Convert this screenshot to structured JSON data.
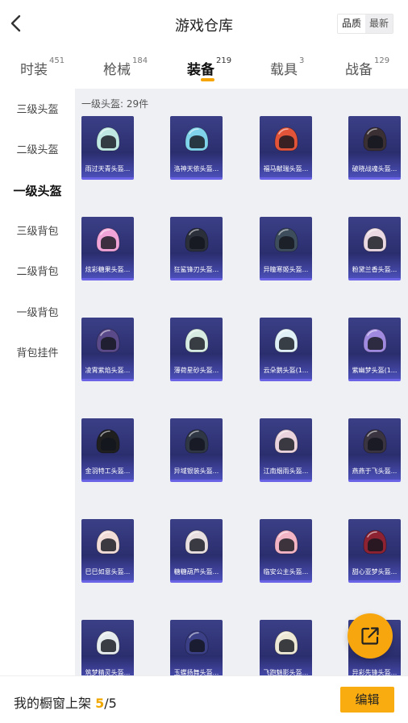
{
  "header": {
    "title": "游戏仓库",
    "sort_options": [
      "品质",
      "最新"
    ],
    "active_sort": "最新"
  },
  "tabs": [
    {
      "label": "时装",
      "count": "451"
    },
    {
      "label": "枪械",
      "count": "184"
    },
    {
      "label": "装备",
      "count": "219"
    },
    {
      "label": "载具",
      "count": "3"
    },
    {
      "label": "战备",
      "count": "129"
    }
  ],
  "active_tab": "装备",
  "sidebar": {
    "items": [
      "三级头盔",
      "二级头盔",
      "一级头盔",
      "三级背包",
      "二级背包",
      "一级背包",
      "背包挂件"
    ],
    "active": "一级头盔"
  },
  "section": {
    "label": "一级头盔: 29件"
  },
  "items": [
    {
      "name": "雨过天青头盔...",
      "color": "#bfe8e2"
    },
    {
      "name": "洛神天依头盔...",
      "color": "#7fd3ea"
    },
    {
      "name": "福马献瑞头盔...",
      "color": "#e2543a"
    },
    {
      "name": "破晓战魂头盔...",
      "color": "#3a2f33"
    },
    {
      "name": "炫彩糖果头盔...",
      "color": "#f0a4d8"
    },
    {
      "name": "狂鲨锋刃头盔...",
      "color": "#2b2f3a"
    },
    {
      "name": "异瞳寒姬头盔...",
      "color": "#3e4d5c"
    },
    {
      "name": "粉黛兰香头盔...",
      "color": "#ead9e2"
    },
    {
      "name": "凌霄紫焰头盔...",
      "color": "#5b4a8a"
    },
    {
      "name": "薄荷星砂头盔...",
      "color": "#d6ece2"
    },
    {
      "name": "云朵鹅头盔(1...",
      "color": "#dff0f6"
    },
    {
      "name": "紫幽梦头盔(1...",
      "color": "#a08ae0"
    },
    {
      "name": "金羽特工头盔...",
      "color": "#1f1f1f"
    },
    {
      "name": "异域银装头盔...",
      "color": "#2f3644"
    },
    {
      "name": "江南烟雨头盔...",
      "color": "#ead3dc"
    },
    {
      "name": "燕燕于飞头盔...",
      "color": "#3a3340"
    },
    {
      "name": "巳巳如意头盔...",
      "color": "#f2dcd8"
    },
    {
      "name": "糖糖葫芦头盔...",
      "color": "#e8e0e0"
    },
    {
      "name": "临安公主头盔...",
      "color": "#f3b4c6"
    },
    {
      "name": "甜心亚梦头盔...",
      "color": "#8c2232"
    },
    {
      "name": "筑梦精灵头盔...",
      "color": "#e6ecee"
    },
    {
      "name": "玉蝶扬舞头盔...",
      "color": "#3b3f86"
    },
    {
      "name": "飞跑魅影头盔...",
      "color": "#eee8d6"
    },
    {
      "name": "异彩先锋头盔...",
      "color": "#d04030"
    }
  ],
  "bottom": {
    "shelf_label": "我的橱窗上架",
    "shelf_used": "5",
    "shelf_total": "/5",
    "edit_label": "编辑"
  },
  "colors": {
    "accent": "#f8ac10",
    "card": "#2b2e6e",
    "card_border": "#6a63e6",
    "content_bg": "#eef0f4"
  },
  "icons": [
    "back-arrow-icon",
    "share-external-icon"
  ]
}
